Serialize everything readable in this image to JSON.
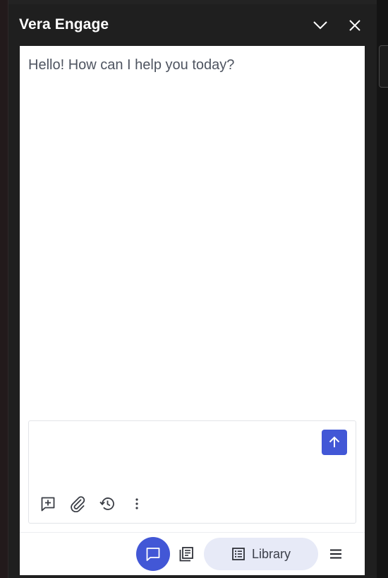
{
  "header": {
    "title": "Vera Engage",
    "collapse_icon": "chevron-down-icon",
    "close_icon": "close-icon"
  },
  "chat": {
    "greeting": "Hello! How can I help you today?"
  },
  "composer": {
    "value": "",
    "placeholder": "",
    "send_icon": "arrow-up-icon",
    "tools": [
      "add-comment-icon",
      "paperclip-icon",
      "history-icon",
      "more-vertical-icon"
    ]
  },
  "bottom_nav": {
    "chat_icon": "chat-bubble-icon",
    "docs_icon": "documents-icon",
    "library_label": "Library",
    "library_icon": "list-icon",
    "menu_icon": "hamburger-icon"
  },
  "colors": {
    "accent": "#4257d6",
    "library_bg": "#e7eaf7",
    "panel_bg": "#1f1f1f",
    "greeting_text": "#4e5460"
  }
}
